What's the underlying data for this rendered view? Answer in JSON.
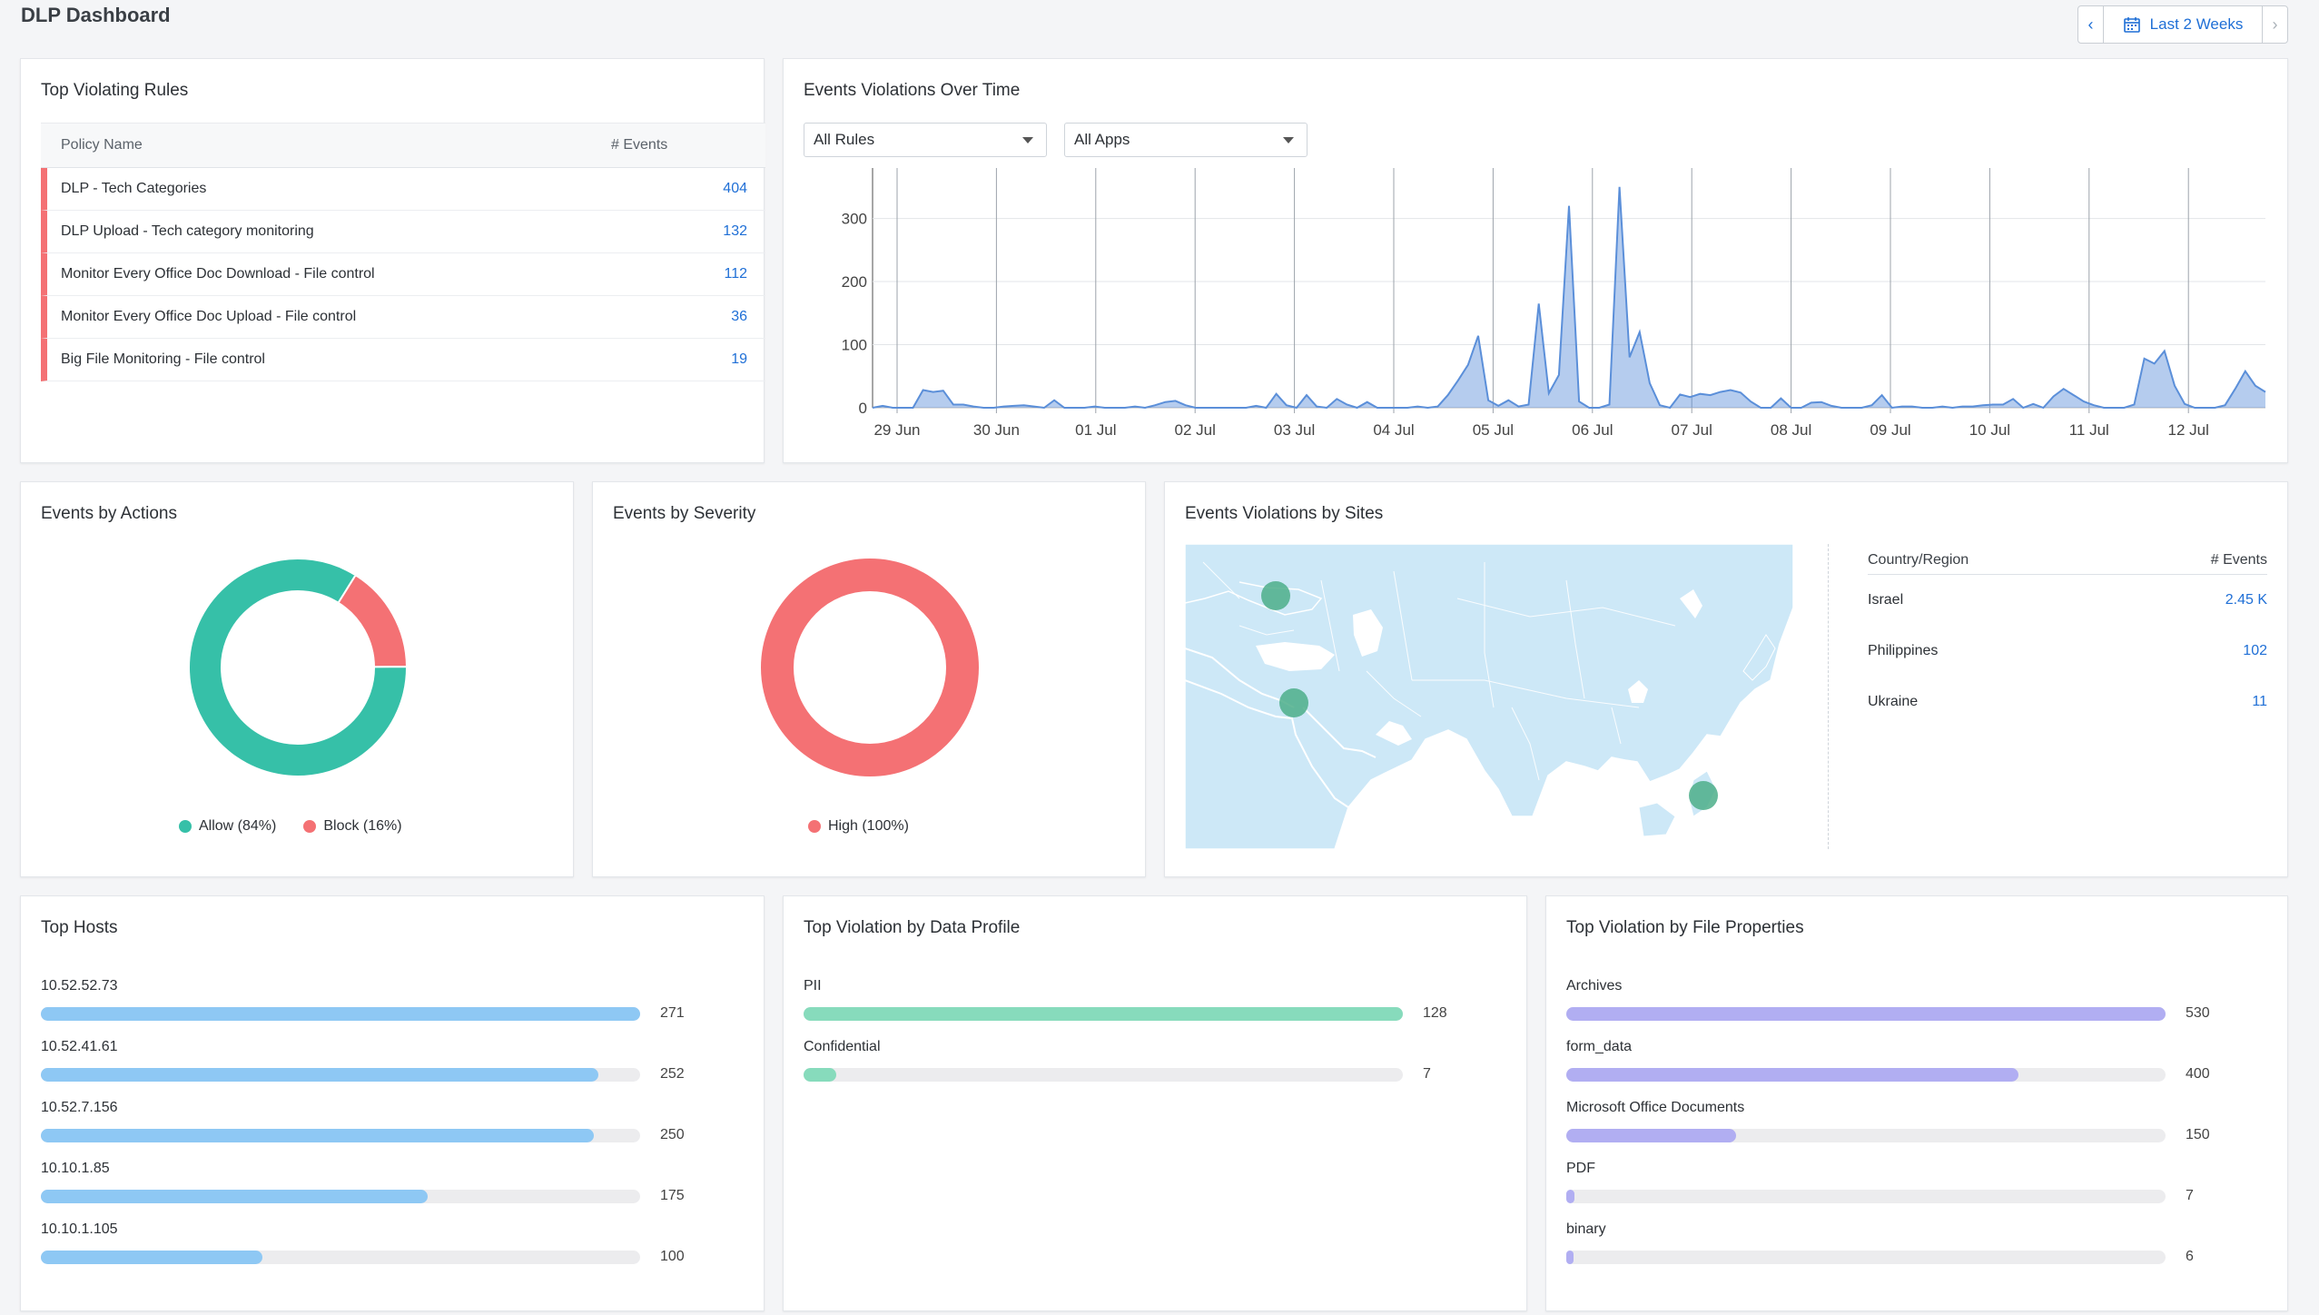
{
  "header": {
    "title": "DLP Dashboard",
    "date_range": "Last 2 Weeks"
  },
  "top_rules": {
    "title": "Top Violating Rules",
    "col_policy": "Policy Name",
    "col_events": "# Events",
    "rows": [
      {
        "name": "DLP - Tech Categories",
        "events": "404"
      },
      {
        "name": "DLP Upload - Tech category monitoring",
        "events": "132"
      },
      {
        "name": "Monitor Every Office Doc Download - File control",
        "events": "112"
      },
      {
        "name": "Monitor Every Office Doc Upload - File control",
        "events": "36"
      },
      {
        "name": "Big File Monitoring - File control",
        "events": "19"
      }
    ],
    "accent_color": "#f47174"
  },
  "over_time": {
    "title": "Events Violations Over Time",
    "filter_rules": "All Rules",
    "filter_apps": "All Apps"
  },
  "actions": {
    "title": "Events by Actions",
    "legend": [
      {
        "label": "Allow (84%)",
        "color": "#36c0a8"
      },
      {
        "label": "Block (16%)",
        "color": "#f47174"
      }
    ]
  },
  "severity": {
    "title": "Events by Severity",
    "legend": [
      {
        "label": "High (100%)",
        "color": "#f47174"
      }
    ]
  },
  "sites": {
    "title": "Events Violations by Sites",
    "col_region": "Country/Region",
    "col_events": "# Events",
    "rows": [
      {
        "region": "Israel",
        "events": "2.45 K"
      },
      {
        "region": "Philippines",
        "events": "102"
      },
      {
        "region": "Ukraine",
        "events": "11"
      }
    ]
  },
  "top_hosts": {
    "title": "Top Hosts",
    "color": "#8ec8f4",
    "max": 271,
    "items": [
      {
        "label": "10.52.52.73",
        "value": 271
      },
      {
        "label": "10.52.41.61",
        "value": 252
      },
      {
        "label": "10.52.7.156",
        "value": 250
      },
      {
        "label": "10.10.1.85",
        "value": 175
      },
      {
        "label": "10.10.1.105",
        "value": 100
      }
    ]
  },
  "data_profile": {
    "title": "Top Violation by Data Profile",
    "color": "#87dbbc",
    "max": 128,
    "items": [
      {
        "label": "PII",
        "value": 128
      },
      {
        "label": "Confidential",
        "value": 7
      }
    ]
  },
  "file_props": {
    "title": "Top Violation by File Properties",
    "color": "#b1aef2",
    "max": 530,
    "items": [
      {
        "label": "Archives",
        "value": 530
      },
      {
        "label": "form_data",
        "value": 400
      },
      {
        "label": "Microsoft Office Documents",
        "value": 150
      },
      {
        "label": "PDF",
        "value": 7
      },
      {
        "label": "binary",
        "value": 6
      }
    ]
  },
  "chart_data": [
    {
      "type": "area",
      "title": "Events Violations Over Time",
      "x_ticks": [
        "29 Jun",
        "30 Jun",
        "01 Jul",
        "02 Jul",
        "03 Jul",
        "04 Jul",
        "05 Jul",
        "06 Jul",
        "07 Jul",
        "08 Jul",
        "09 Jul",
        "10 Jul",
        "11 Jul",
        "12 Jul"
      ],
      "y_ticks": [
        0,
        100,
        200,
        300
      ],
      "ylim": [
        0,
        380
      ],
      "grid": "vertical at day ticks, horizontal at y ticks",
      "color": "#5b8fd9",
      "values": [
        0,
        3,
        0,
        0,
        0,
        28,
        25,
        27,
        5,
        5,
        2,
        0,
        0,
        2,
        3,
        4,
        2,
        0,
        12,
        0,
        0,
        0,
        2,
        0,
        0,
        0,
        2,
        0,
        4,
        9,
        11,
        4,
        0,
        0,
        0,
        0,
        0,
        0,
        3,
        0,
        22,
        4,
        0,
        20,
        2,
        0,
        14,
        5,
        0,
        9,
        0,
        0,
        0,
        0,
        2,
        0,
        2,
        20,
        43,
        68,
        114,
        12,
        3,
        12,
        2,
        5,
        165,
        23,
        52,
        320,
        10,
        0,
        0,
        5,
        350,
        80,
        120,
        39,
        4,
        0,
        21,
        17,
        22,
        20,
        25,
        28,
        24,
        10,
        0,
        0,
        15,
        0,
        0,
        8,
        9,
        3,
        0,
        0,
        0,
        4,
        20,
        0,
        2,
        2,
        0,
        0,
        2,
        0,
        2,
        2,
        4,
        5,
        5,
        14,
        0,
        6,
        0,
        18,
        30,
        20,
        10,
        4,
        0,
        0,
        0,
        5,
        78,
        70,
        90,
        35,
        6,
        0,
        0,
        0,
        4,
        30,
        58,
        35,
        25
      ]
    },
    {
      "type": "pie",
      "title": "Events by Actions",
      "donut": true,
      "slices": [
        {
          "label": "Allow",
          "value": 84,
          "color": "#36c0a8"
        },
        {
          "label": "Block",
          "value": 16,
          "color": "#f47174"
        }
      ]
    },
    {
      "type": "pie",
      "title": "Events by Severity",
      "donut": true,
      "slices": [
        {
          "label": "High",
          "value": 100,
          "color": "#f47174"
        }
      ]
    },
    {
      "type": "bar",
      "title": "Top Hosts",
      "orientation": "horizontal",
      "categories": [
        "10.52.52.73",
        "10.52.41.61",
        "10.52.7.156",
        "10.10.1.85",
        "10.10.1.105"
      ],
      "values": [
        271,
        252,
        250,
        175,
        100
      ]
    },
    {
      "type": "bar",
      "title": "Top Violation by Data Profile",
      "orientation": "horizontal",
      "categories": [
        "PII",
        "Confidential"
      ],
      "values": [
        128,
        7
      ]
    },
    {
      "type": "bar",
      "title": "Top Violation by File Properties",
      "orientation": "horizontal",
      "categories": [
        "Archives",
        "form_data",
        "Microsoft Office Documents",
        "PDF",
        "binary"
      ],
      "values": [
        530,
        400,
        150,
        7,
        6
      ]
    }
  ]
}
